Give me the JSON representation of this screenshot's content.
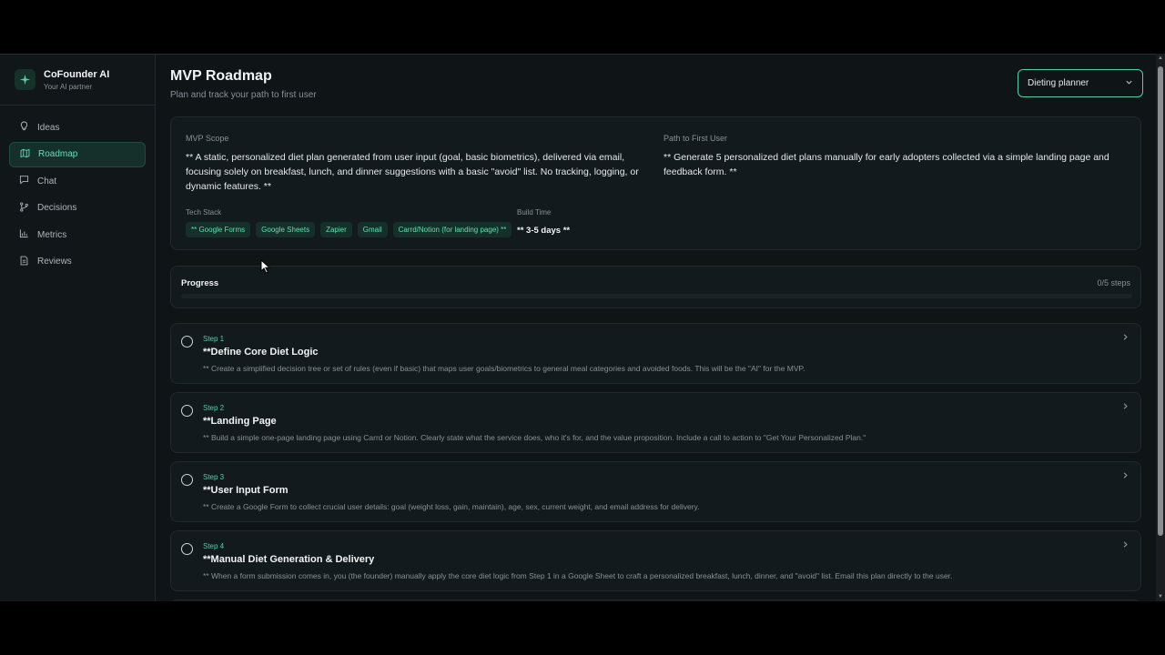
{
  "brand": {
    "name": "CoFounder AI",
    "subtitle": "Your AI partner",
    "logo_icon": "sparkle-icon"
  },
  "sidebar": {
    "items": [
      {
        "label": "Ideas",
        "icon": "lightbulb-icon",
        "active": false
      },
      {
        "label": "Roadmap",
        "icon": "map-icon",
        "active": true
      },
      {
        "label": "Chat",
        "icon": "chat-bubble-icon",
        "active": false
      },
      {
        "label": "Decisions",
        "icon": "branch-icon",
        "active": false
      },
      {
        "label": "Metrics",
        "icon": "bar-chart-icon",
        "active": false
      },
      {
        "label": "Reviews",
        "icon": "document-icon",
        "active": false
      }
    ]
  },
  "header": {
    "title": "MVP Roadmap",
    "subtitle": "Plan and track your path to first user",
    "project_select": {
      "value": "Dieting planner"
    }
  },
  "scope": {
    "mvp_label": "MVP Scope",
    "mvp_text": "** A static, personalized diet plan generated from user input (goal, basic biometrics), delivered via email, focusing solely on breakfast, lunch, and dinner suggestions with a basic \"avoid\" list. No tracking, logging, or dynamic features. **",
    "path_label": "Path to First User",
    "path_text": "** Generate 5 personalized diet plans manually for early adopters collected via a simple landing page and feedback form. **",
    "tech_label": "Tech Stack",
    "tech_stack": [
      "** Google Forms",
      "Google Sheets",
      "Zapier",
      "Gmail",
      "Carrd/Notion (for landing page) **"
    ],
    "build_label": "Build Time",
    "build_value": "** 3-5 days **"
  },
  "progress": {
    "label": "Progress",
    "count_text": "0/5 steps",
    "fraction": 0.0
  },
  "steps": [
    {
      "num": "Step 1",
      "title": "**Define Core Diet Logic",
      "desc": "** Create a simplified decision tree or set of rules (even if basic) that maps user goals/biometrics to general meal categories and avoided foods. This will be the \"AI\" for the MVP."
    },
    {
      "num": "Step 2",
      "title": "**Landing Page",
      "desc": "** Build a simple one-page landing page using Carrd or Notion. Clearly state what the service does, who it's for, and the value proposition. Include a call to action to \"Get Your Personalized Plan.\""
    },
    {
      "num": "Step 3",
      "title": "**User Input Form",
      "desc": "** Create a Google Form to collect crucial user details: goal (weight loss, gain, maintain), age, sex, current weight, and email address for delivery."
    },
    {
      "num": "Step 4",
      "title": "**Manual Diet Generation & Delivery",
      "desc": "** When a form submission comes in, you (the founder) manually apply the core diet logic from Step 1 in a Google Sheet to craft a personalized breakfast, lunch, dinner, and \"avoid\" list. Email this plan directly to the user."
    }
  ],
  "colors": {
    "accent": "#4ed1a8",
    "background": "#0f1417",
    "card": "#121a1d"
  }
}
